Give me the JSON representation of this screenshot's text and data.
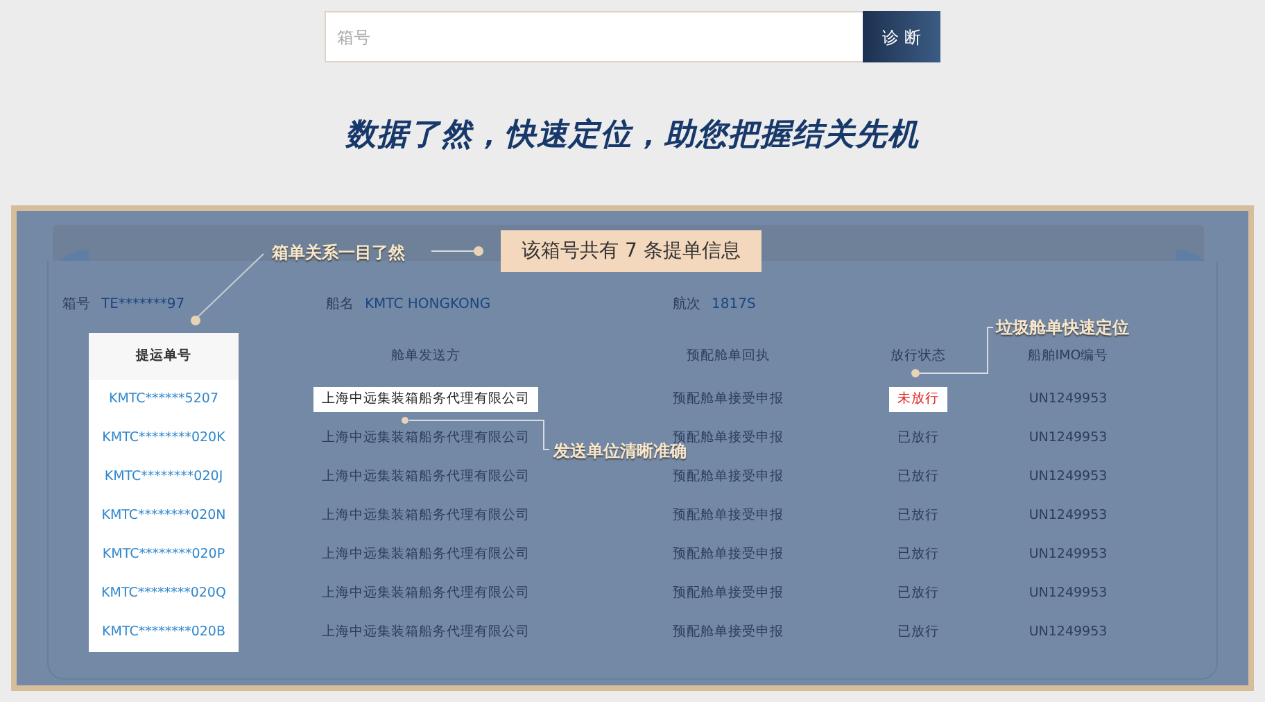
{
  "search": {
    "placeholder": "箱号",
    "button": "诊 断"
  },
  "slogan": "数据了然，快速定位，助您把握结关先机",
  "summary": "该箱号共有 7 条提单信息",
  "info": [
    {
      "label": "箱号",
      "value": "TE*******97"
    },
    {
      "label": "船名",
      "value": "KMTC HONGKONG"
    },
    {
      "label": "航次",
      "value": "1817S"
    }
  ],
  "table": {
    "columns": [
      {
        "label": "提运单号",
        "highlighted": true
      },
      {
        "label": "舱单发送方",
        "highlighted": false
      },
      {
        "label": "预配舱单回执",
        "highlighted": false
      },
      {
        "label": "放行状态",
        "highlighted": false
      },
      {
        "label": "船舶IMO编号",
        "highlighted": false
      }
    ],
    "rows": [
      {
        "highlighted": true,
        "released": false,
        "cells": [
          "KMTC******5207",
          "上海中远集装箱船务代理有限公司",
          "预配舱单接受申报",
          "未放行",
          "UN1249953"
        ]
      },
      {
        "highlighted": false,
        "released": true,
        "cells": [
          "KMTC********020K",
          "上海中远集装箱船务代理有限公司",
          "预配舱单接受申报",
          "已放行",
          "UN1249953"
        ]
      },
      {
        "highlighted": false,
        "released": true,
        "cells": [
          "KMTC********020J",
          "上海中远集装箱船务代理有限公司",
          "预配舱单接受申报",
          "已放行",
          "UN1249953"
        ]
      },
      {
        "highlighted": false,
        "released": true,
        "cells": [
          "KMTC********020N",
          "上海中远集装箱船务代理有限公司",
          "预配舱单接受申报",
          "已放行",
          "UN1249953"
        ]
      },
      {
        "highlighted": false,
        "released": true,
        "cells": [
          "KMTC********020P",
          "上海中远集装箱船务代理有限公司",
          "预配舱单接受申报",
          "已放行",
          "UN1249953"
        ]
      },
      {
        "highlighted": false,
        "released": true,
        "cells": [
          "KMTC********020Q",
          "上海中远集装箱船务代理有限公司",
          "预配舱单接受申报",
          "已放行",
          "UN1249953"
        ]
      },
      {
        "highlighted": false,
        "released": true,
        "cells": [
          "KMTC********020B",
          "上海中远集装箱船务代理有限公司",
          "预配舱单接受申报",
          "已放行",
          "UN1249953"
        ]
      }
    ]
  },
  "callouts": [
    {
      "text": "箱单关系一目了然"
    },
    {
      "text": "发送单位清晰准确"
    },
    {
      "text": "垃圾舱单快速定位"
    }
  ]
}
